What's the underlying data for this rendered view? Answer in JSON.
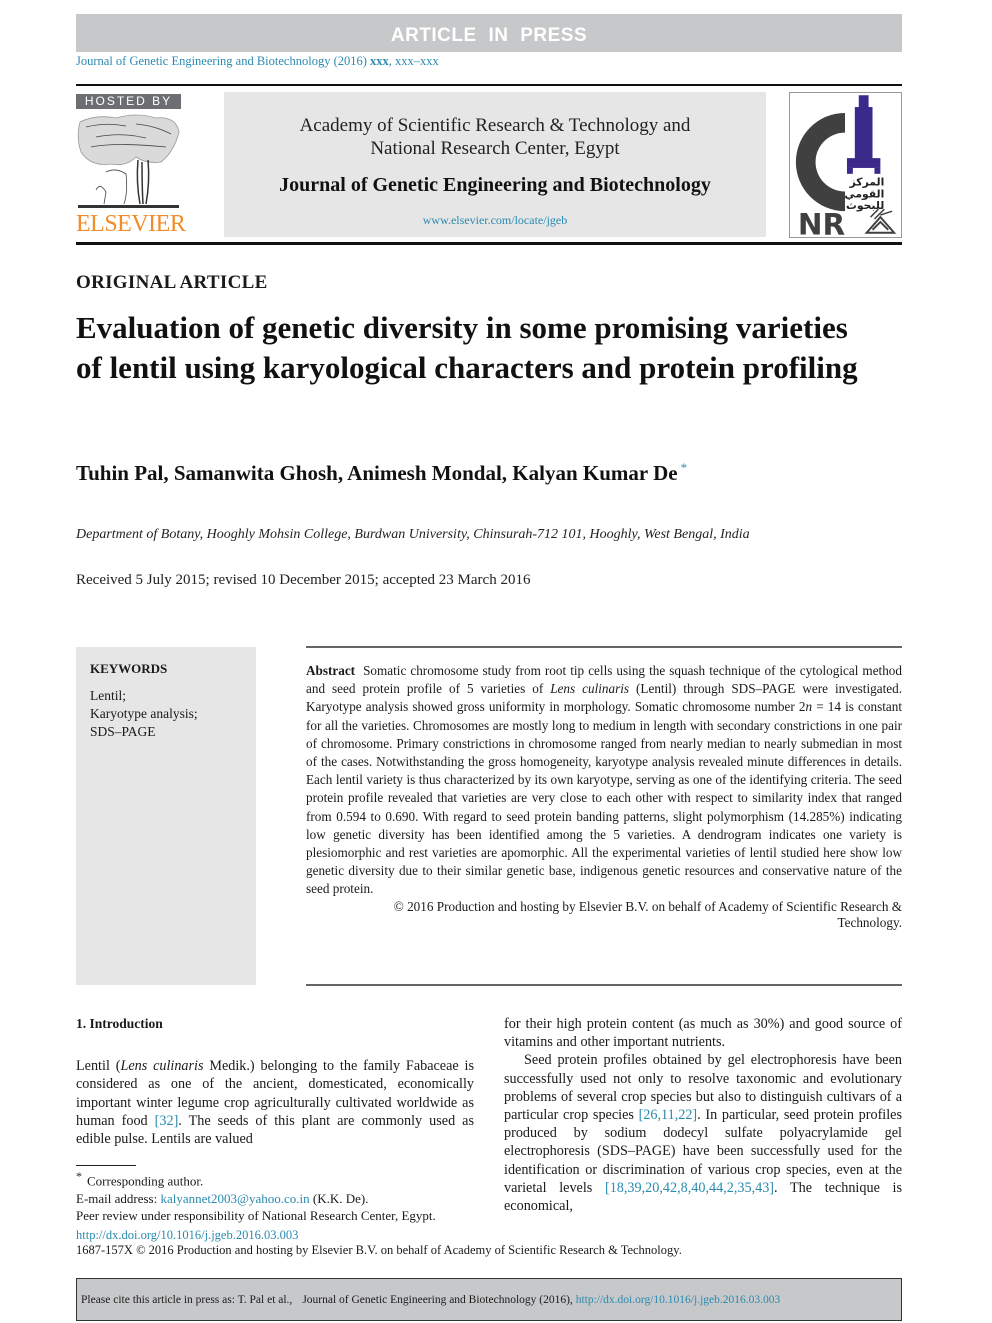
{
  "banner": {
    "text": "ARTICLE IN PRESS"
  },
  "journal_ref": {
    "journal": "Journal of Genetic Engineering and Biotechnology (2016)",
    "volume": "xxx",
    "pages": ", xxx–xxx"
  },
  "header": {
    "hosted_by": "HOSTED BY",
    "publisher_logo": "ELSEVIER",
    "academy_line1": "Academy of Scientific Research & Technology and",
    "academy_line2": "National Research Center, Egypt",
    "journal_title": "Journal of Genetic Engineering and Biotechnology",
    "url": "www.elsevier.com/locate/jgeb",
    "nrc_arabic": [
      "المركز",
      "القومي",
      "للبحوث"
    ],
    "nrc_letters": "NR",
    "colors": {
      "elsevier_orange": "#f28c28",
      "nrc_purple": "#3b2a8c",
      "nrc_gray": "#404040",
      "link_blue": "#2a8ab0"
    }
  },
  "article": {
    "section_label": "ORIGINAL ARTICLE",
    "title": "Evaluation of genetic diversity in some promising varieties of lentil using karyological characters and protein profiling",
    "authors": "Tuhin Pal, Samanwita Ghosh, Animesh Mondal, Kalyan Kumar De",
    "corresponding_marker": "*",
    "affiliation": "Department of Botany, Hooghly Mohsin College, Burdwan University, Chinsurah-712 101, Hooghly, West Bengal, India",
    "dates": "Received 5 July 2015; revised 10 December 2015; accepted 23 March 2016"
  },
  "keywords": {
    "title": "KEYWORDS",
    "items": [
      "Lentil;",
      "Karyotype analysis;",
      "SDS–PAGE"
    ]
  },
  "abstract": {
    "label": "Abstract",
    "text_part1": "Somatic chromosome study from root tip cells using the squash technique of the cytological method and seed protein profile of 5 varieties of ",
    "species": "Lens culinaris",
    "text_part2": " (Lentil) through SDS–PAGE were investigated. Karyotype analysis showed gross uniformity in morphology. Somatic chromosome number 2",
    "n_italic": "n",
    "text_part3": " = 14 is constant for all the varieties. Chromosomes are mostly long to medium in length with secondary constrictions in one pair of chromosome. Primary constrictions in chromosome ranged from nearly median to nearly submedian in most of the cases. Notwithstanding the gross homogeneity, karyotype analysis revealed minute differences in details. Each lentil variety is thus characterized by its own karyotype, serving as one of the identifying criteria. The seed protein profile revealed that varieties are very close to each other with respect to similarity index that ranged from 0.594 to 0.690. With regard to seed protein banding patterns, slight polymorphism (14.285%) indicating low genetic diversity has been identified among the 5 varieties. A dendrogram indicates one variety is plesiomorphic and rest varieties are apomorphic. All the experimental varieties of lentil studied here show low genetic diversity due to their similar genetic base, indigenous genetic resources and conservative nature of the seed protein.",
    "copyright_line1": "© 2016 Production and hosting by Elsevier B.V. on behalf of Academy of Scientific Research &",
    "copyright_line2": "Technology."
  },
  "introduction": {
    "heading": "1. Introduction",
    "p1_a": "Lentil (",
    "p1_species": "Lens culinaris",
    "p1_b": " Medik.) belonging to the family Fabaceae is considered as one of the ancient, domesticated, economically important winter legume crop agriculturally cultivated worldwide as human food ",
    "p1_ref": "[32]",
    "p1_c": ". The seeds of this plant are commonly used as edible pulse. Lentils are valued",
    "p1_cont": "for their high protein content (as much as 30%) and good source of vitamins and other important nutrients.",
    "p2_a": "Seed protein profiles obtained by gel electrophoresis have been successfully used not only to resolve taxonomic and evolutionary problems of several crop species but also to distinguish cultivars of a particular crop species ",
    "p2_ref1": "[26,11,22]",
    "p2_b": ". In particular, seed protein profiles produced by sodium dodecyl sulfate polyacrylamide gel electrophoresis (SDS–PAGE) have been successfully used for the identification or discrimination of various crop species, even at the varietal levels ",
    "p2_ref2": "[18,39,20,42,8,40,44,2,35,43]",
    "p2_c": ". The technique is economical,"
  },
  "footnotes": {
    "corresponding": "Corresponding author.",
    "email_label": "E-mail address: ",
    "email": "kalyannet2003@yahoo.co.in",
    "email_suffix": " (K.K. De).",
    "peer_review": "Peer review under responsibility of National Research Center, Egypt."
  },
  "doi": "http://dx.doi.org/10.1016/j.jgeb.2016.03.003",
  "issn_line": "1687-157X © 2016 Production and hosting by Elsevier B.V. on behalf of Academy of Scientific Research & Technology.",
  "citation": {
    "prefix": "Please cite this article in press as: T. Pal et al.,",
    "journal": "Journal of Genetic Engineering and Biotechnology (2016),",
    "link": "http://dx.doi.org/10.1016/j.jgeb.2016.03.003"
  }
}
